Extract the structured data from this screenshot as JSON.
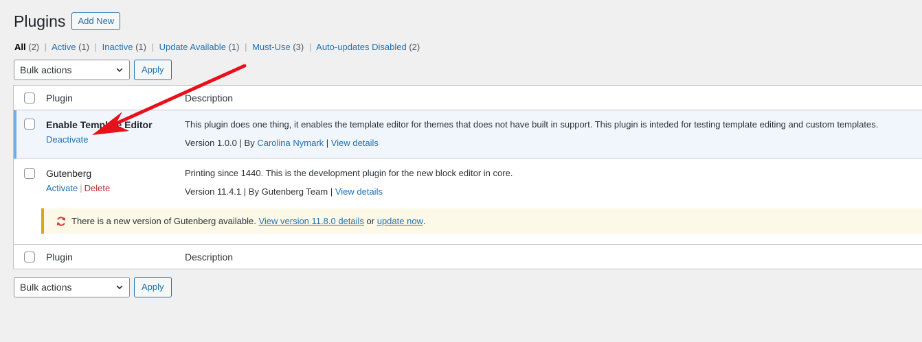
{
  "page": {
    "title": "Plugins",
    "add_new_label": "Add New"
  },
  "filters": {
    "all": {
      "label": "All",
      "count": "(2)"
    },
    "active": {
      "label": "Active",
      "count": "(1)"
    },
    "inactive": {
      "label": "Inactive",
      "count": "(1)"
    },
    "update_available": {
      "label": "Update Available",
      "count": "(1)"
    },
    "must_use": {
      "label": "Must-Use",
      "count": "(3)"
    },
    "autoupdates_disabled": {
      "label": "Auto-updates Disabled",
      "count": "(2)"
    },
    "separator": "|"
  },
  "bulk": {
    "select_label": "Bulk actions",
    "apply_label": "Apply"
  },
  "table": {
    "col_plugin": "Plugin",
    "col_description": "Description"
  },
  "plugins": [
    {
      "name": "Enable Template Editor",
      "action_primary": "Deactivate",
      "description": "This plugin does one thing, it enables the template editor for themes that does not have built in support. This plugin is inteded for testing template editing and custom templates.",
      "version": "Version 1.0.0",
      "by": "By",
      "author": "Carolina Nymark",
      "view_details": "View details",
      "sep": "|"
    },
    {
      "name": "Gutenberg",
      "action_primary": "Activate",
      "action_delete": "Delete",
      "description": "Printing since 1440. This is the development plugin for the new block editor in core.",
      "version": "Version 11.4.1",
      "by_author": "By Gutenberg Team",
      "view_details": "View details",
      "sep": "|"
    }
  ],
  "update_notice": {
    "text_before": "There is a new version of Gutenberg available.",
    "link_version": "View version 11.8.0 details",
    "text_or": "or",
    "link_update": "update now",
    "text_end": "."
  },
  "colors": {
    "link": "#2271b1",
    "annotation_arrow": "#e8101a",
    "active_border": "#72aee6",
    "notice_border": "#dba617"
  },
  "icons": {
    "update": "update-icon",
    "dropdown": "chevron-down-icon",
    "arrow": "red-arrow-annotation-icon"
  }
}
